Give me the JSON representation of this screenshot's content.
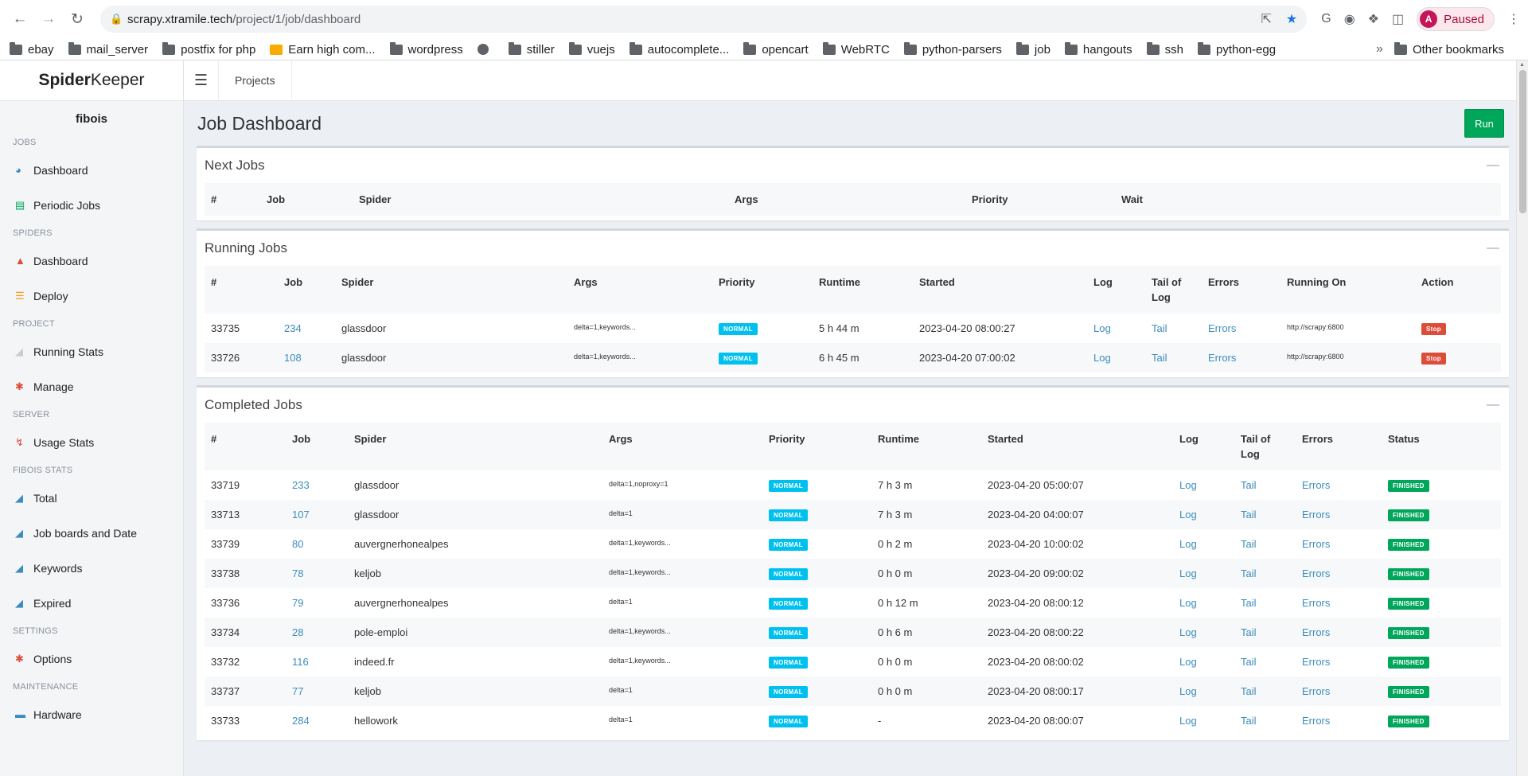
{
  "browser": {
    "url_host": "scrapy.xtramile.tech",
    "url_path": "/project/1/job/dashboard",
    "profile_initial": "A",
    "profile_status": "Paused",
    "bookmarks": [
      {
        "label": "ebay",
        "icon": "folder-icon"
      },
      {
        "label": "mail_server",
        "icon": "folder-icon"
      },
      {
        "label": "postfix for php",
        "icon": "folder-icon"
      },
      {
        "label": "Earn high com...",
        "icon": "earn-icon"
      },
      {
        "label": "wordpress",
        "icon": "folder-icon"
      },
      {
        "label": "",
        "icon": "globe-icon"
      },
      {
        "label": "stiller",
        "icon": "folder-icon"
      },
      {
        "label": "vuejs",
        "icon": "folder-icon"
      },
      {
        "label": "autocomplete...",
        "icon": "folder-icon"
      },
      {
        "label": "opencart",
        "icon": "folder-icon"
      },
      {
        "label": "WebRTC",
        "icon": "folder-icon"
      },
      {
        "label": "python-parsers",
        "icon": "folder-icon"
      },
      {
        "label": "job",
        "icon": "folder-icon"
      },
      {
        "label": "hangouts",
        "icon": "folder-icon"
      },
      {
        "label": "ssh",
        "icon": "folder-icon"
      },
      {
        "label": "python-egg",
        "icon": "folder-icon"
      }
    ],
    "other_bookmarks": "Other bookmarks"
  },
  "sidebar": {
    "logo_bold": "Spider",
    "logo_rest": "Keeper",
    "user": "fibois",
    "sections": [
      {
        "header": "JOBS",
        "items": [
          {
            "label": "Dashboard",
            "icon": "dashboard-icon"
          },
          {
            "label": "Periodic Jobs",
            "icon": "tasks-icon"
          }
        ]
      },
      {
        "header": "SPIDERS",
        "items": [
          {
            "label": "Dashboard",
            "icon": "flask-icon"
          },
          {
            "label": "Deploy",
            "icon": "server-icon"
          }
        ]
      },
      {
        "header": "PROJECT",
        "items": [
          {
            "label": "Running Stats",
            "icon": "area-chart-icon"
          },
          {
            "label": "Manage",
            "icon": "cogs-icon"
          }
        ]
      },
      {
        "header": "SERVER",
        "items": [
          {
            "label": "Usage Stats",
            "icon": "bolt-icon"
          }
        ]
      },
      {
        "header": "FIBOIS STATS",
        "items": [
          {
            "label": "Total",
            "icon": "area-chart-icon"
          },
          {
            "label": "Job boards and Date",
            "icon": "area-chart-icon"
          },
          {
            "label": "Keywords",
            "icon": "area-chart-icon"
          },
          {
            "label": "Expired",
            "icon": "area-chart-icon"
          }
        ]
      },
      {
        "header": "SETTINGS",
        "items": [
          {
            "label": "Options",
            "icon": "cogs-icon"
          }
        ]
      },
      {
        "header": "MAINTENANCE",
        "items": [
          {
            "label": "Hardware",
            "icon": "hdd-icon"
          }
        ]
      }
    ]
  },
  "topnav": {
    "projects": "Projects"
  },
  "page": {
    "title": "Job Dashboard",
    "run_label": "Run"
  },
  "next_jobs": {
    "title": "Next Jobs",
    "columns": [
      "#",
      "Job",
      "Spider",
      "Args",
      "Priority",
      "Wait"
    ],
    "rows": []
  },
  "running_jobs": {
    "title": "Running Jobs",
    "columns": [
      "#",
      "Job",
      "Spider",
      "Args",
      "Priority",
      "Runtime",
      "Started",
      "Log",
      "Tail of Log",
      "Errors",
      "Running On",
      "Action"
    ],
    "rows": [
      {
        "id": "33735",
        "job": "234",
        "spider": "glassdoor",
        "args": "delta=1,keywords...",
        "priority": "NORMAL",
        "runtime": "5 h 44 m",
        "started": "2023-04-20 08:00:27",
        "log": "Log",
        "tail": "Tail",
        "errors": "Errors",
        "running_on": "http://scrapy:6800",
        "action": "Stop"
      },
      {
        "id": "33726",
        "job": "108",
        "spider": "glassdoor",
        "args": "delta=1,keywords...",
        "priority": "NORMAL",
        "runtime": "6 h 45 m",
        "started": "2023-04-20 07:00:02",
        "log": "Log",
        "tail": "Tail",
        "errors": "Errors",
        "running_on": "http://scrapy:6800",
        "action": "Stop"
      }
    ]
  },
  "completed_jobs": {
    "title": "Completed Jobs",
    "columns": [
      "#",
      "Job",
      "Spider",
      "Args",
      "Priority",
      "Runtime",
      "Started",
      "Log",
      "Tail of Log",
      "Errors",
      "Status"
    ],
    "rows": [
      {
        "id": "33719",
        "job": "233",
        "spider": "glassdoor",
        "args": "delta=1,noproxy=1",
        "priority": "NORMAL",
        "runtime": "7 h 3 m",
        "started": "2023-04-20 05:00:07",
        "log": "Log",
        "tail": "Tail",
        "errors": "Errors",
        "status": "FINISHED"
      },
      {
        "id": "33713",
        "job": "107",
        "spider": "glassdoor",
        "args": "delta=1",
        "priority": "NORMAL",
        "runtime": "7 h 3 m",
        "started": "2023-04-20 04:00:07",
        "log": "Log",
        "tail": "Tail",
        "errors": "Errors",
        "status": "FINISHED"
      },
      {
        "id": "33739",
        "job": "80",
        "spider": "auvergnerhonealpes",
        "args": "delta=1,keywords...",
        "priority": "NORMAL",
        "runtime": "0 h 2 m",
        "started": "2023-04-20 10:00:02",
        "log": "Log",
        "tail": "Tail",
        "errors": "Errors",
        "status": "FINISHED"
      },
      {
        "id": "33738",
        "job": "78",
        "spider": "keljob",
        "args": "delta=1,keywords...",
        "priority": "NORMAL",
        "runtime": "0 h 0 m",
        "started": "2023-04-20 09:00:02",
        "log": "Log",
        "tail": "Tail",
        "errors": "Errors",
        "status": "FINISHED"
      },
      {
        "id": "33736",
        "job": "79",
        "spider": "auvergnerhonealpes",
        "args": "delta=1",
        "priority": "NORMAL",
        "runtime": "0 h 12 m",
        "started": "2023-04-20 08:00:12",
        "log": "Log",
        "tail": "Tail",
        "errors": "Errors",
        "status": "FINISHED"
      },
      {
        "id": "33734",
        "job": "28",
        "spider": "pole-emploi",
        "args": "delta=1,keywords...",
        "priority": "NORMAL",
        "runtime": "0 h 6 m",
        "started": "2023-04-20 08:00:22",
        "log": "Log",
        "tail": "Tail",
        "errors": "Errors",
        "status": "FINISHED"
      },
      {
        "id": "33732",
        "job": "116",
        "spider": "indeed.fr",
        "args": "delta=1,keywords...",
        "priority": "NORMAL",
        "runtime": "0 h 0 m",
        "started": "2023-04-20 08:00:02",
        "log": "Log",
        "tail": "Tail",
        "errors": "Errors",
        "status": "FINISHED"
      },
      {
        "id": "33737",
        "job": "77",
        "spider": "keljob",
        "args": "delta=1",
        "priority": "NORMAL",
        "runtime": "0 h 0 m",
        "started": "2023-04-20 08:00:17",
        "log": "Log",
        "tail": "Tail",
        "errors": "Errors",
        "status": "FINISHED"
      },
      {
        "id": "33733",
        "job": "284",
        "spider": "hellowork",
        "args": "delta=1",
        "priority": "NORMAL",
        "runtime": "-",
        "started": "2023-04-20 08:00:07",
        "log": "Log",
        "tail": "Tail",
        "errors": "Errors",
        "status": "FINISHED"
      }
    ]
  },
  "colors": {
    "accent": "#3c8dbc",
    "success": "#00a65a",
    "danger": "#dd4b39",
    "info": "#00c0ef"
  }
}
